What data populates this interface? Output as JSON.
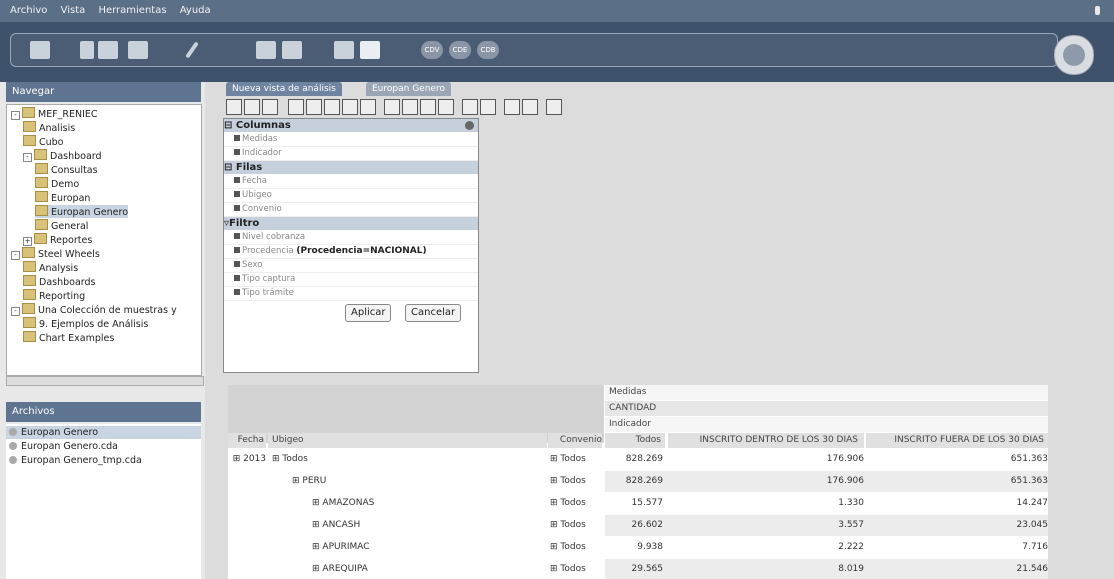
{
  "menubar": {
    "items": [
      "Archivo",
      "Vista",
      "Herramientas",
      "Ayuda"
    ]
  },
  "toolbar": {
    "cda_labels": [
      "CDV",
      "CDE",
      "CDB"
    ]
  },
  "navigation": {
    "title": "Navegar",
    "tree": [
      {
        "label": "MEF_RENIEC",
        "level": 0,
        "exp": "-"
      },
      {
        "label": "Analisis",
        "level": 1
      },
      {
        "label": "Cubo",
        "level": 1
      },
      {
        "label": "Dashboard",
        "level": 1,
        "exp": "-"
      },
      {
        "label": "Consultas",
        "level": 2
      },
      {
        "label": "Demo",
        "level": 2
      },
      {
        "label": "Europan",
        "level": 2
      },
      {
        "label": "Europan Genero",
        "level": 2,
        "selected": true
      },
      {
        "label": "General",
        "level": 2
      },
      {
        "label": "Reportes",
        "level": 1,
        "exp": "+"
      },
      {
        "label": "Steel Wheels",
        "level": 0,
        "exp": "-"
      },
      {
        "label": "Analysis",
        "level": 1
      },
      {
        "label": "Dashboards",
        "level": 1
      },
      {
        "label": "Reporting",
        "level": 1
      },
      {
        "label": "Una Colección de muestras y",
        "level": 0,
        "exp": "-"
      },
      {
        "label": "9. Ejemplos de Análisis",
        "level": 1
      },
      {
        "label": "Chart Examples",
        "level": 1
      }
    ]
  },
  "archivos": {
    "title": "Archivos",
    "files": [
      "Europan Genero",
      "Europan Genero.cda",
      "Europan Genero_tmp.cda"
    ]
  },
  "tabs": [
    "Nueva vista de análisis",
    "Europan Genero"
  ],
  "panel": {
    "columnas": "Columnas",
    "col_rows": [
      "Medidas",
      "Indicador"
    ],
    "filas": "Filas",
    "filas_rows": [
      "Fecha",
      "Ubigeo",
      "Convenio"
    ],
    "filtro": "Filtro",
    "filtro_rows": [
      {
        "label": "Nivel cobranza",
        "bold": ""
      },
      {
        "label": "Procedencia",
        "bold": "(Procedencia=NACIONAL)"
      },
      {
        "label": "Sexo",
        "bold": ""
      },
      {
        "label": "Tipo captura",
        "bold": ""
      },
      {
        "label": "Tipo trámite",
        "bold": ""
      }
    ],
    "apply": "Aplicar",
    "cancel": "Cancelar"
  },
  "table": {
    "meas_header": "Medidas",
    "meas_name": "CANTIDAD",
    "ind_header": "Indicador",
    "col_fecha": "Fecha",
    "col_ubigeo": "Ubigeo",
    "col_convenio": "Convenio",
    "col_todos": "Todos",
    "col_dentro": "INSCRITO DENTRO DE LOS 30 DIAS",
    "col_fuera": "INSCRITO FUERA DE LOS 30 DIAS",
    "rows": [
      {
        "fecha": "2013",
        "ubigeo": "Todos",
        "convenio": "Todos",
        "todos": "828.269",
        "dentro": "176.906",
        "fuera": "651.363"
      },
      {
        "fecha": "",
        "ubigeo": "PERU",
        "convenio": "Todos",
        "todos": "828.269",
        "dentro": "176.906",
        "fuera": "651.363"
      },
      {
        "fecha": "",
        "ubigeo": "AMAZONAS",
        "convenio": "Todos",
        "todos": "15.577",
        "dentro": "1.330",
        "fuera": "14.247"
      },
      {
        "fecha": "",
        "ubigeo": "ANCASH",
        "convenio": "Todos",
        "todos": "26.602",
        "dentro": "3.557",
        "fuera": "23.045"
      },
      {
        "fecha": "",
        "ubigeo": "APURIMAC",
        "convenio": "Todos",
        "todos": "9.938",
        "dentro": "2.222",
        "fuera": "7.716"
      },
      {
        "fecha": "",
        "ubigeo": "AREQUIPA",
        "convenio": "Todos",
        "todos": "29.565",
        "dentro": "8.019",
        "fuera": "21.546"
      }
    ]
  }
}
